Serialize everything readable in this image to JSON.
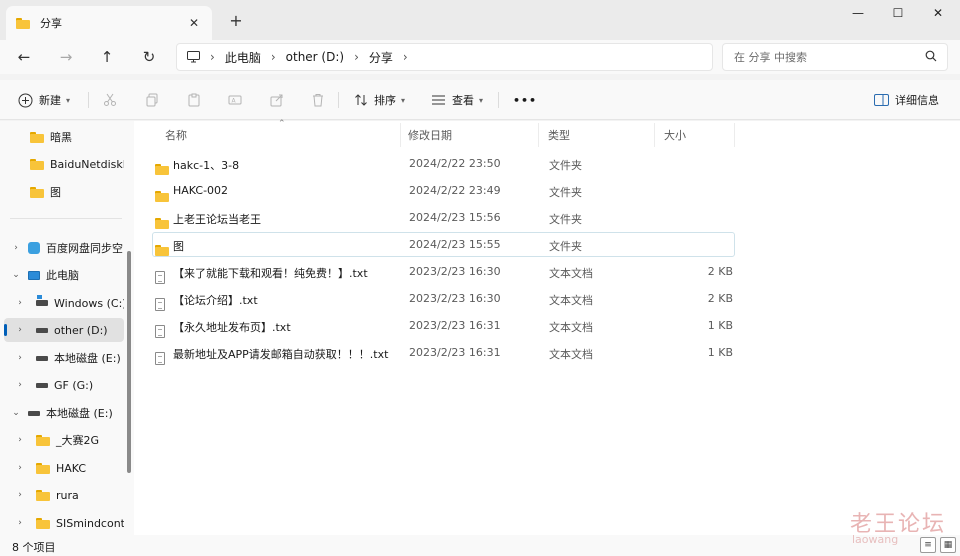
{
  "window": {
    "tab_title": "分享",
    "tab_close": "✕",
    "tab_add": "+",
    "minimize": "—",
    "maximize": "☐",
    "close": "✕"
  },
  "nav": {
    "back": "←",
    "forward": "→",
    "up": "↑",
    "refresh": "↻"
  },
  "address": {
    "crumbs": [
      "此电脑",
      "other (D:)",
      "分享"
    ],
    "sep": "›"
  },
  "search": {
    "placeholder": "在 分享 中搜索",
    "icon": "search-icon"
  },
  "toolbar": {
    "new_label": "新建",
    "sort_label": "排序",
    "view_label": "查看",
    "more_label": "•••",
    "details_label": "详细信息"
  },
  "sidebar": {
    "items": [
      {
        "label": "暗黑",
        "icon": "folder-icon"
      },
      {
        "label": "BaiduNetdiskDownload",
        "icon": "folder-icon"
      },
      {
        "label": "图",
        "icon": "folder-icon"
      },
      {
        "label": "百度网盘同步空间",
        "icon": "cloud-icon"
      },
      {
        "label": "此电脑",
        "icon": "pc-icon"
      },
      {
        "label": "Windows (C:)",
        "icon": "windows-drive-icon"
      },
      {
        "label": "other (D:)",
        "icon": "drive-icon"
      },
      {
        "label": "本地磁盘 (E:)",
        "icon": "drive-icon"
      },
      {
        "label": "GF (G:)",
        "icon": "drive-icon"
      },
      {
        "label": "本地磁盘 (E:)",
        "icon": "drive-icon"
      },
      {
        "label": "_大赛2G",
        "icon": "folder-icon"
      },
      {
        "label": "HAKC",
        "icon": "folder-icon"
      },
      {
        "label": "rura",
        "icon": "folder-icon"
      },
      {
        "label": "SISmindcontrol",
        "icon": "folder-icon"
      }
    ]
  },
  "columns": {
    "name": "名称",
    "date": "修改日期",
    "type": "类型",
    "size": "大小"
  },
  "files": [
    {
      "name": "hakc-1、3-8",
      "date": "2024/2/22 23:50",
      "type": "文件夹",
      "size": "",
      "icon": "folder-icon"
    },
    {
      "name": "HAKC-002",
      "date": "2024/2/22 23:49",
      "type": "文件夹",
      "size": "",
      "icon": "folder-icon"
    },
    {
      "name": "上老王论坛当老王",
      "date": "2024/2/23 15:56",
      "type": "文件夹",
      "size": "",
      "icon": "folder-icon"
    },
    {
      "name": "图",
      "date": "2024/2/23 15:55",
      "type": "文件夹",
      "size": "",
      "icon": "folder-icon"
    },
    {
      "name": "【来了就能下载和观看！纯免费！】.txt",
      "date": "2023/2/23 16:30",
      "type": "文本文档",
      "size": "2 KB",
      "icon": "text-file-icon"
    },
    {
      "name": "【论坛介绍】.txt",
      "date": "2023/2/23 16:30",
      "type": "文本文档",
      "size": "2 KB",
      "icon": "text-file-icon"
    },
    {
      "name": "【永久地址发布页】.txt",
      "date": "2023/2/23 16:31",
      "type": "文本文档",
      "size": "1 KB",
      "icon": "text-file-icon"
    },
    {
      "name": "最新地址及APP请发邮箱自动获取！！！.txt",
      "date": "2023/2/23 16:31",
      "type": "文本文档",
      "size": "1 KB",
      "icon": "text-file-icon"
    }
  ],
  "status": {
    "count_text": "8 个项目"
  },
  "watermark": {
    "title": "老王论坛",
    "sub": "laowang"
  }
}
